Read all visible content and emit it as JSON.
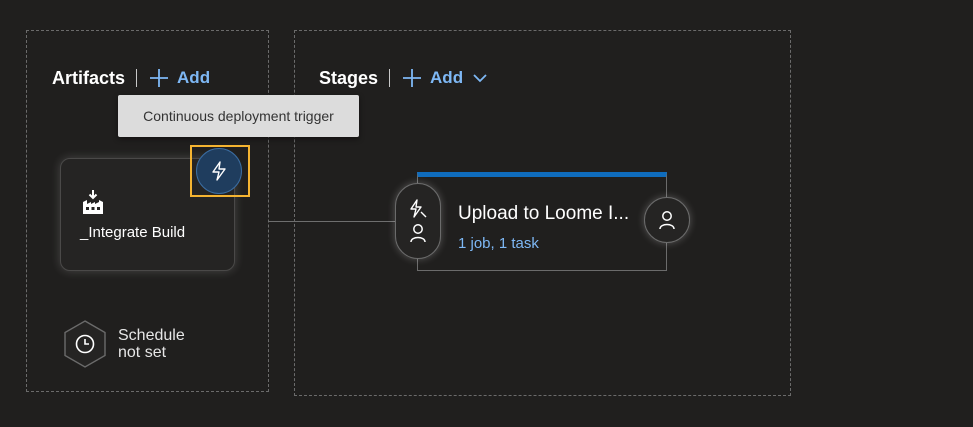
{
  "artifacts": {
    "title": "Artifacts",
    "add_label": "Add",
    "tooltip": "Continuous deployment trigger",
    "card": {
      "name": "_Integrate Build",
      "icon": "build-artifact-icon"
    },
    "schedule": {
      "line1": "Schedule",
      "line2": "not set",
      "icon": "clock-icon"
    }
  },
  "stages": {
    "title": "Stages",
    "add_label": "Add",
    "items": [
      {
        "name": "Upload to Loome I...",
        "summary": "1 job, 1 task"
      }
    ]
  },
  "colors": {
    "background": "#201f1e",
    "accent": "#7eb8f5",
    "stage_top_bar": "#0f6cbd",
    "trigger_highlight": "#f5b431"
  }
}
